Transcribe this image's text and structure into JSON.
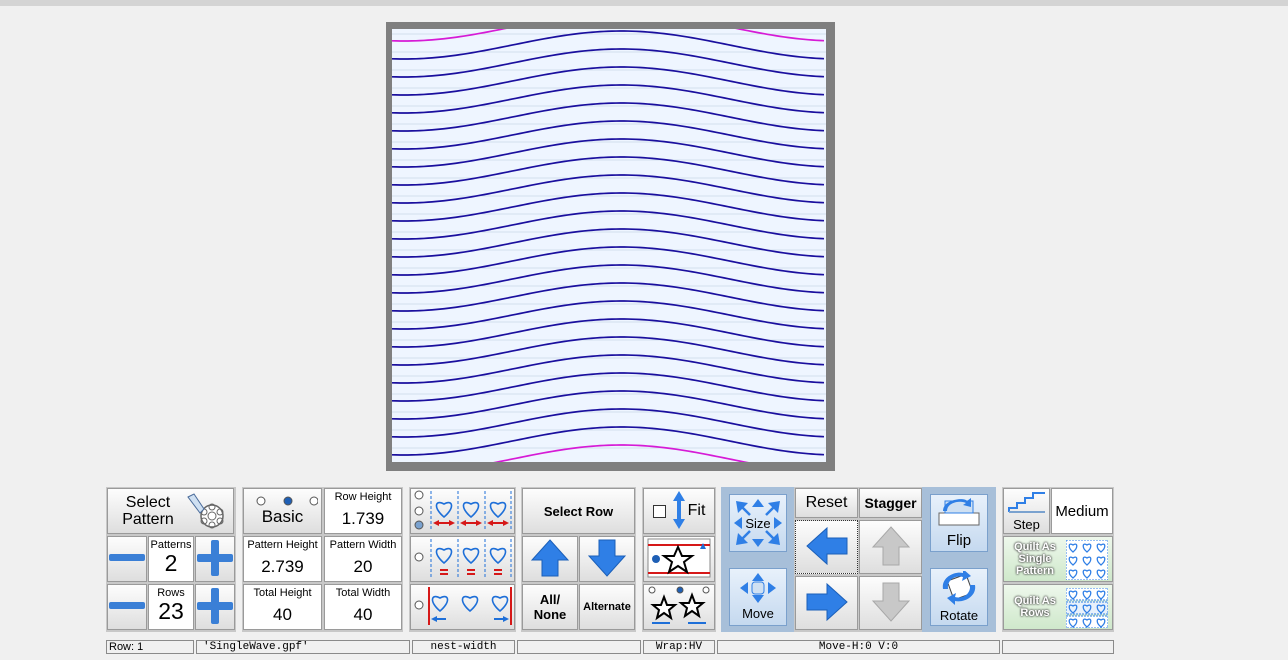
{
  "controls": {
    "select_pattern_label": "Select Pattern",
    "patterns_label": "Patterns",
    "patterns_value": "2",
    "rows_label": "Rows",
    "rows_value": "23",
    "mode_label": "Basic",
    "row_height_label": "Row Height",
    "row_height_value": "1.739",
    "pattern_height_label": "Pattern Height",
    "pattern_height_value": "2.739",
    "pattern_width_label": "Pattern Width",
    "pattern_width_value": "20",
    "total_height_label": "Total Height",
    "total_height_value": "40",
    "total_width_label": "Total Width",
    "total_width_value": "40",
    "select_row_label": "Select Row",
    "all_none_label": "All/ None",
    "alternate_label": "Alternate",
    "fit_label": "Fit",
    "size_label": "Size",
    "move_label": "Move",
    "reset_label": "Reset",
    "stagger_label": "Stagger",
    "flip_label": "Flip",
    "rotate_label": "Rotate",
    "step_label": "Step",
    "step_value": "Medium",
    "quilt_single_label": "Quilt As Single Pattern",
    "quilt_rows_label": "Quilt As Rows"
  },
  "status": {
    "row": "Row: 1",
    "file": "'SingleWave.gpf'",
    "nest": "nest-width",
    "blank": "",
    "wrap": "Wrap:HV",
    "move": "Move-H:0 V:0"
  },
  "colors": {
    "wave": "#1a0f9e",
    "edge_wave": "#d61bd6",
    "canvas_bg": "#eef5ff",
    "panel_blue": "#a7bfd9",
    "arrow_blue": "#2f7fe6",
    "quilt_green": "#dbefd9"
  }
}
